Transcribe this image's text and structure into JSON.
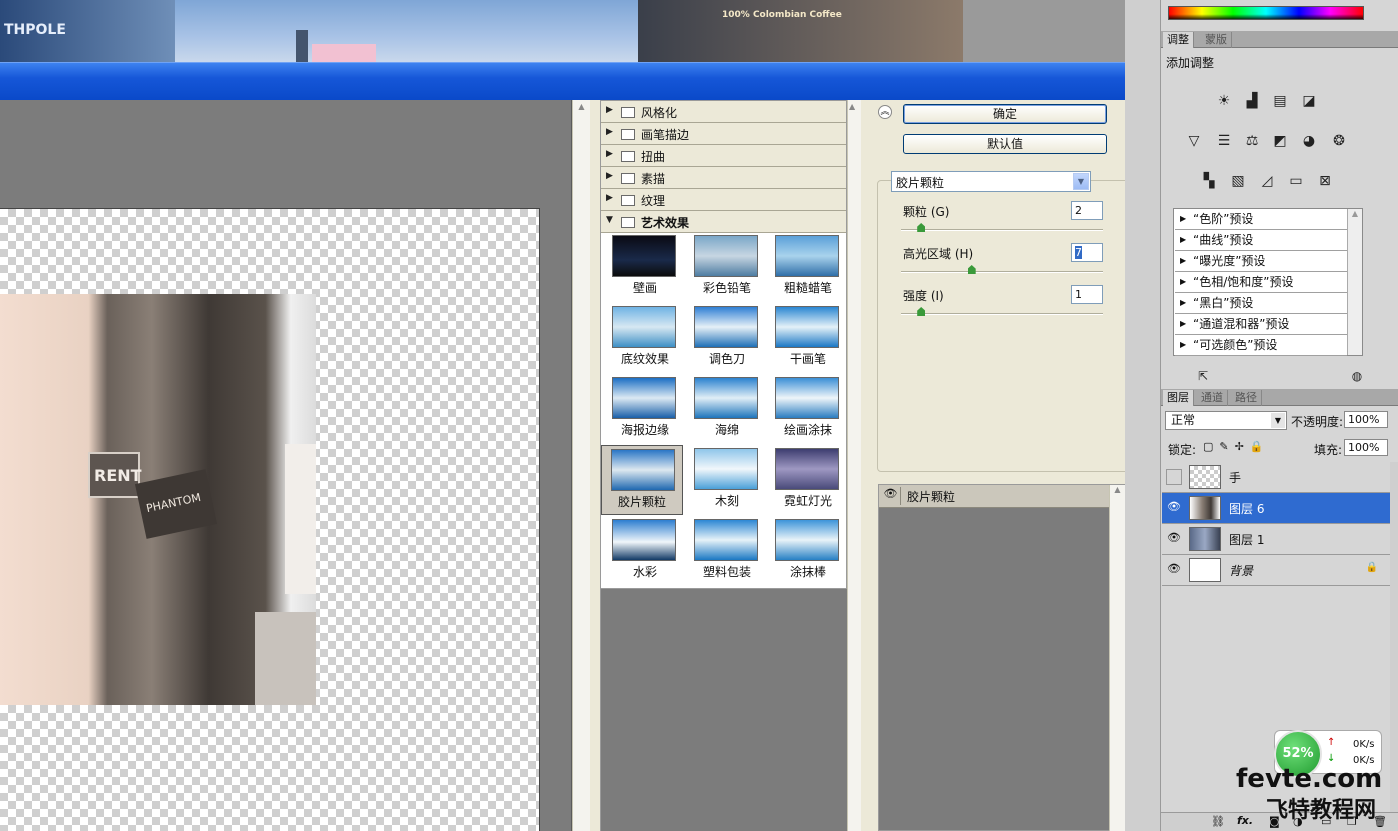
{
  "background": {
    "sign_left": "THPOLE",
    "sign_right": "100% Colombian Coffee"
  },
  "preview": {
    "photo_signs": [
      "RENT",
      "PHANTOM"
    ]
  },
  "gallery": {
    "categories": [
      {
        "label": "风格化",
        "expanded": false
      },
      {
        "label": "画笔描边",
        "expanded": false
      },
      {
        "label": "扭曲",
        "expanded": false
      },
      {
        "label": "素描",
        "expanded": false
      },
      {
        "label": "纹理",
        "expanded": false
      },
      {
        "label": "艺术效果",
        "expanded": true
      }
    ],
    "filters": [
      {
        "label": "壁画"
      },
      {
        "label": "彩色铅笔"
      },
      {
        "label": "粗糙蜡笔"
      },
      {
        "label": "底纹效果"
      },
      {
        "label": "调色刀"
      },
      {
        "label": "干画笔"
      },
      {
        "label": "海报边缘"
      },
      {
        "label": "海绵"
      },
      {
        "label": "绘画涂抹"
      },
      {
        "label": "胶片颗粒",
        "selected": true
      },
      {
        "label": "木刻"
      },
      {
        "label": "霓虹灯光"
      },
      {
        "label": "水彩"
      },
      {
        "label": "塑料包装"
      },
      {
        "label": "涂抹棒"
      }
    ]
  },
  "settings": {
    "ok_label": "确定",
    "default_label": "默认值",
    "filter_select": "胶片颗粒",
    "params": [
      {
        "label": "颗粒 (G)",
        "value": "2",
        "level": 0.1
      },
      {
        "label": "高光区域 (H)",
        "value": "7",
        "level": 0.35
      },
      {
        "label": "强度 (I)",
        "value": "1",
        "level": 0.1
      }
    ],
    "effect_layer": "胶片颗粒"
  },
  "adjust_panel": {
    "tabs": [
      "调整",
      "蒙版"
    ],
    "title": "添加调整",
    "presets": [
      "“色阶”预设",
      "“曲线”预设",
      "“曝光度”预设",
      "“色相/饱和度”预设",
      "“黑白”预设",
      "“通道混和器”预设",
      "“可选颜色”预设"
    ]
  },
  "layers_panel": {
    "tabs": [
      "图层",
      "通道",
      "路径"
    ],
    "blend_mode": "正常",
    "opacity_label": "不透明度:",
    "opacity": "100%",
    "lock_label": "锁定:",
    "fill_label": "填充:",
    "fill": "100%",
    "layers": [
      {
        "name": "手",
        "visible": false,
        "selected": false,
        "locked": false
      },
      {
        "name": "图层 6",
        "visible": true,
        "selected": true,
        "locked": false
      },
      {
        "name": "图层 1",
        "visible": true,
        "selected": false,
        "locked": false
      },
      {
        "name": "背景",
        "visible": true,
        "selected": false,
        "locked": true
      }
    ]
  },
  "net_widget": {
    "percent": "52%",
    "up": "0K/s",
    "down": "0K/s"
  },
  "watermark": {
    "line1": "fevte.com",
    "line2": "飞特教程网"
  }
}
